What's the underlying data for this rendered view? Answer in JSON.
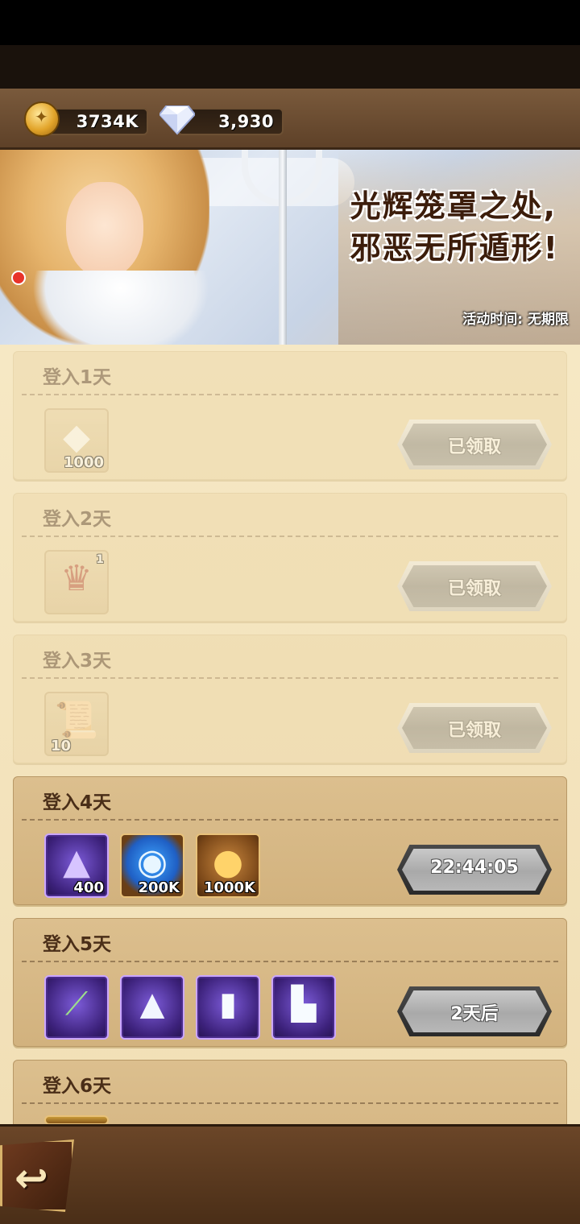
{
  "currency": {
    "gold": "3734K",
    "diamonds": "3,930"
  },
  "banner": {
    "title_line1": "光辉笼罩之处,",
    "title_line2": "邪恶无所遁形!",
    "event_time": "活动时间: 无期限"
  },
  "days": [
    {
      "title": "登入1天",
      "status": "已领取",
      "items": [
        {
          "icon": "diamond-icon",
          "qty": "1000"
        }
      ]
    },
    {
      "title": "登入2天",
      "status": "已领取",
      "items": [
        {
          "icon": "hero-card-icon",
          "qty": "1"
        }
      ]
    },
    {
      "title": "登入3天",
      "status": "已领取",
      "items": [
        {
          "icon": "scroll-icon",
          "qty": "10"
        }
      ]
    },
    {
      "title": "登入4天",
      "status": "22:44:05",
      "items": [
        {
          "icon": "purple-dust-icon",
          "qty": "400"
        },
        {
          "icon": "blue-orb-icon",
          "qty": "200K"
        },
        {
          "icon": "gold-coin-icon",
          "qty": "1000K"
        }
      ]
    },
    {
      "title": "登入5天",
      "status": "2天后",
      "items": [
        {
          "icon": "staff-icon",
          "qty": ""
        },
        {
          "icon": "wizard-hat-icon",
          "qty": ""
        },
        {
          "icon": "robe-icon",
          "qty": ""
        },
        {
          "icon": "boots-icon",
          "qty": ""
        }
      ]
    },
    {
      "title": "登入6天",
      "status": "",
      "items": []
    }
  ],
  "colors": {
    "panel_bg": "#f1dfb6",
    "card_active": "#d2b27e",
    "title_text": "#4a2e18"
  }
}
